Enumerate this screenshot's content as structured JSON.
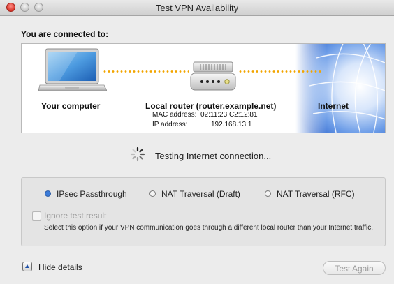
{
  "window": {
    "title": "Test VPN Availability"
  },
  "connection": {
    "heading": "You are connected to:",
    "computer_label": "Your computer",
    "router_label": "Local router (router.example.net)",
    "mac_key": "MAC address:",
    "mac_value": "02:11:23:C2:12:81",
    "ip_key": "IP address:",
    "ip_value": "192.168.13.1",
    "internet_label": "Internet"
  },
  "status": {
    "text": "Testing Internet connection..."
  },
  "options": {
    "radios": [
      {
        "label": "IPsec Passthrough",
        "selected": true
      },
      {
        "label": "NAT Traversal (Draft)",
        "selected": false
      },
      {
        "label": "NAT Traversal (RFC)",
        "selected": false
      }
    ],
    "ignore_label": "Ignore test result",
    "ignore_checked": false,
    "ignore_description": "Select this option if your VPN communication goes through a different local router than your Internet traffic."
  },
  "footer": {
    "hide_details_label": "Hide details",
    "test_again_label": "Test Again"
  },
  "colors": {
    "accent": "#3b7bd8",
    "dots": "#f2a500",
    "globe": "#2f6fd6"
  },
  "icons": [
    "laptop-icon",
    "router-icon",
    "globe-icon",
    "spinner-icon",
    "disclosure-triangle-icon"
  ]
}
